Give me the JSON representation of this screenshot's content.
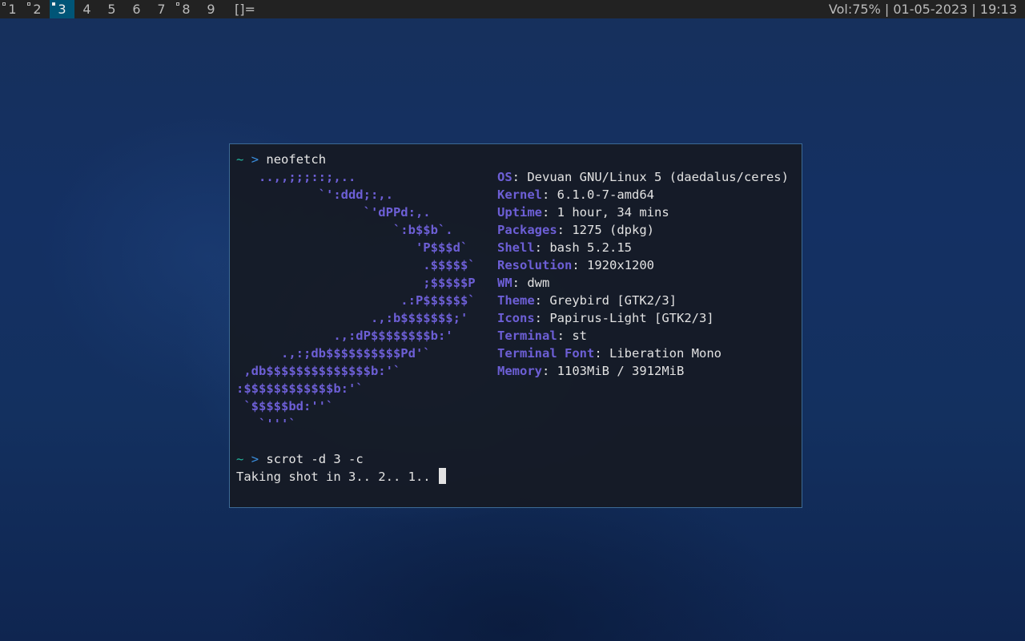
{
  "statusbar": {
    "tags": [
      {
        "label": "1",
        "occupied": true,
        "selected": false
      },
      {
        "label": "2",
        "occupied": true,
        "selected": false
      },
      {
        "label": "3",
        "occupied": true,
        "selected": true
      },
      {
        "label": "4",
        "occupied": false,
        "selected": false
      },
      {
        "label": "5",
        "occupied": false,
        "selected": false
      },
      {
        "label": "6",
        "occupied": false,
        "selected": false
      },
      {
        "label": "7",
        "occupied": false,
        "selected": false
      },
      {
        "label": "8",
        "occupied": true,
        "selected": false
      },
      {
        "label": "9",
        "occupied": false,
        "selected": false
      }
    ],
    "layout_symbol": "[]=",
    "status_text": "Vol:75% | 01-05-2023 | 19:13"
  },
  "terminal": {
    "prompt_tilde": "~",
    "prompt_arrow": ">",
    "command1": "neofetch",
    "ascii_logo": "   ..,,;;;::;,..\n           `':ddd;:,.\n                 `'dPPd:,.\n                     `:b$$b`.\n                        'P$$$d`\n                         .$$$$$`\n                         ;$$$$$P\n                      .:P$$$$$$`\n                  .,:b$$$$$$$;'\n             .,:dP$$$$$$$$b:'\n      .,:;db$$$$$$$$$$Pd'`\n ,db$$$$$$$$$$$$$$b:'`\n:$$$$$$$$$$$$b:'`\n `$$$$$bd:''`\n   `'''`",
    "info": [
      {
        "key": "OS",
        "value": "Devuan GNU/Linux 5 (daedalus/ceres)"
      },
      {
        "key": "Kernel",
        "value": "6.1.0-7-amd64"
      },
      {
        "key": "Uptime",
        "value": "1 hour, 34 mins"
      },
      {
        "key": "Packages",
        "value": "1275 (dpkg)"
      },
      {
        "key": "Shell",
        "value": "bash 5.2.15"
      },
      {
        "key": "Resolution",
        "value": "1920x1200"
      },
      {
        "key": "WM",
        "value": "dwm"
      },
      {
        "key": "Theme",
        "value": "Greybird [GTK2/3]"
      },
      {
        "key": "Icons",
        "value": "Papirus-Light [GTK2/3]"
      },
      {
        "key": "Terminal",
        "value": "st"
      },
      {
        "key": "Terminal Font",
        "value": "Liberation Mono"
      },
      {
        "key": "Memory",
        "value": "1103MiB / 3912MiB"
      }
    ],
    "info_separator": ": ",
    "command2": "scrot -d 3 -c",
    "output_line": "Taking shot in 3.. 2.. 1.."
  },
  "colors": {
    "bar_background": "#222222",
    "bar_text": "#bbbbbb",
    "selected_tag": "#005577",
    "terminal_background": "#161a24",
    "terminal_border": "#3c6a96",
    "logo_accent": "#6d5fd6",
    "prompt_tilde": "#25b8a0",
    "prompt_arrow": "#3a8fe0"
  }
}
